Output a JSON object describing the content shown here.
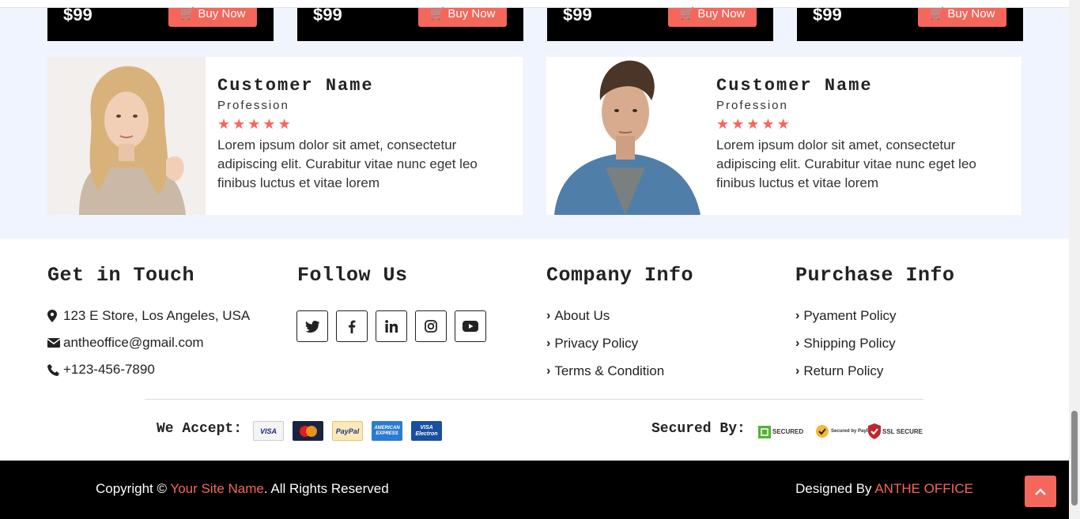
{
  "products": [
    {
      "price": "$99",
      "buy_label": "Buy Now"
    },
    {
      "price": "$99",
      "buy_label": "Buy Now"
    },
    {
      "price": "$99",
      "buy_label": "Buy Now"
    },
    {
      "price": "$99",
      "buy_label": "Buy Now"
    }
  ],
  "testimonials": [
    {
      "name": "Customer Name",
      "profession": "Profession",
      "rating": 5,
      "text": "Lorem ipsum dolor sit amet, consectetur adipiscing elit. Curabitur vitae nunc eget leo finibus luctus et vitae lorem"
    },
    {
      "name": "Customer Name",
      "profession": "Profession",
      "rating": 5,
      "text": "Lorem ipsum dolor sit amet, consectetur adipiscing elit. Curabitur vitae nunc eget leo finibus luctus et vitae lorem"
    }
  ],
  "footer": {
    "contact": {
      "title": "Get in Touch",
      "address": "123 E Store, Los Angeles, USA",
      "email": "antheoffice@gmail.com",
      "phone": "+123-456-7890"
    },
    "follow": {
      "title": "Follow Us",
      "icons": [
        "twitter-icon",
        "facebook-icon",
        "linkedin-icon",
        "instagram-icon",
        "youtube-icon"
      ]
    },
    "company": {
      "title": "Company Info",
      "links": [
        "About Us",
        "Privacy Policy",
        "Terms & Condition"
      ]
    },
    "purchase": {
      "title": "Purchase Info",
      "links": [
        "Pyament Policy",
        "Shipping Policy",
        "Return Policy"
      ]
    },
    "accept_label": "We Accept:",
    "payment_cards": [
      "VISA",
      "MasterCard",
      "PayPal",
      "AMERICAN EXPRESS",
      "VISA Electron"
    ],
    "secured_label": "Secured By:",
    "security_badges": [
      "SECURED",
      "Secured by PayPal",
      "SSL SECURE"
    ]
  },
  "bottom": {
    "copyright_prefix": "Copyright © ",
    "site_name": "Your Site Name",
    "copyright_suffix": ". All Rights Reserved",
    "designed_prefix": "Designed By ",
    "designer": "ANTHE OFFICE"
  },
  "colors": {
    "accent": "#f5665b",
    "testimonial_bg": "#f0f4fe",
    "footer_bar": "#000000"
  }
}
